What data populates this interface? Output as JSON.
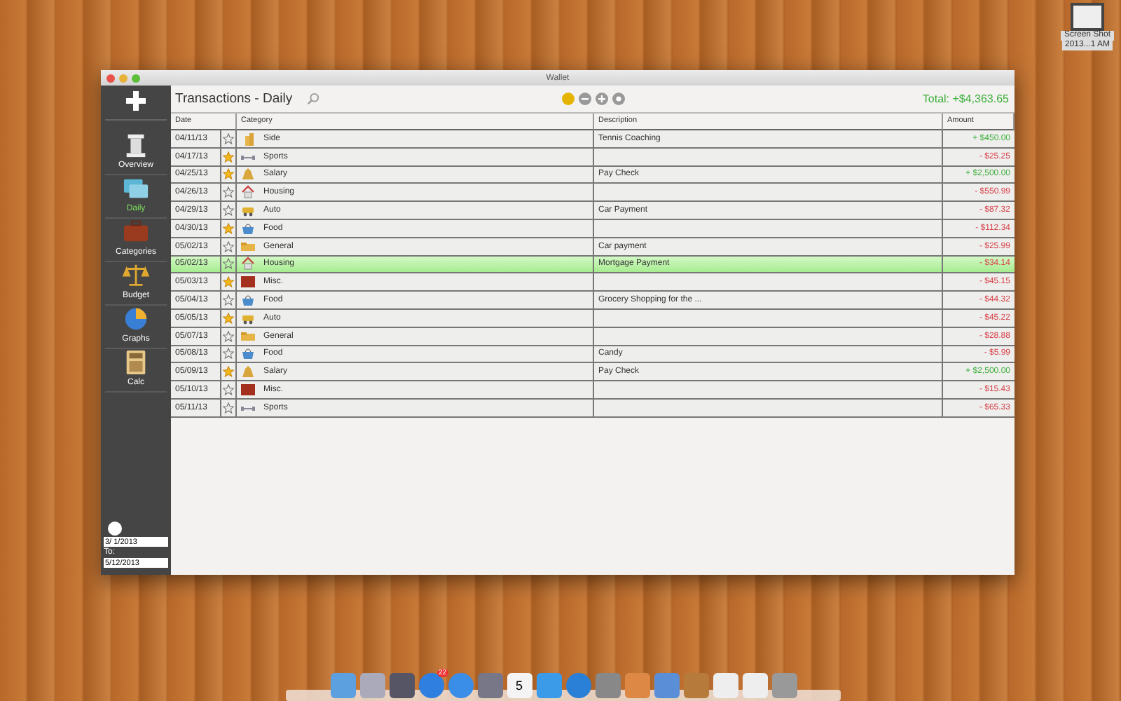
{
  "desktop_icon": {
    "label_line_1": "Screen Shot",
    "label_line_2": "2013...1 AM"
  },
  "window": {
    "title": "Wallet"
  },
  "sidebar": {
    "items": [
      {
        "label": "Overview",
        "kind": "column",
        "selected": false
      },
      {
        "label": "Daily",
        "kind": "cards",
        "selected": true
      },
      {
        "label": "Categories",
        "kind": "briefcase",
        "selected": false
      },
      {
        "label": "Budget",
        "kind": "scale",
        "selected": false
      },
      {
        "label": "Graphs",
        "kind": "pie",
        "selected": false
      },
      {
        "label": "Calc",
        "kind": "calculator",
        "selected": false
      }
    ],
    "from_date": "3/ 1/2013",
    "to_label": "To:",
    "to_date": "5/12/2013"
  },
  "toolbar": {
    "title": "Transactions - Daily",
    "total": "Total: +$4,363.65"
  },
  "table": {
    "columns": [
      "Date",
      "Category",
      "Description",
      "Amount"
    ],
    "rows": [
      {
        "date": "04/11/13",
        "starred": false,
        "category": "Side",
        "kind": "side",
        "description": "Tennis Coaching",
        "amount": "+ $450.00",
        "positive": true,
        "selected": false
      },
      {
        "date": "04/17/13",
        "starred": true,
        "category": "Sports",
        "kind": "sports",
        "description": "",
        "amount": "- $25.25",
        "positive": false,
        "selected": false
      },
      {
        "date": "04/25/13",
        "starred": true,
        "category": "Salary",
        "kind": "salary",
        "description": "Pay Check",
        "amount": "+ $2,500.00",
        "positive": true,
        "selected": false
      },
      {
        "date": "04/26/13",
        "starred": false,
        "category": "Housing",
        "kind": "housing",
        "description": "",
        "amount": "- $550.99",
        "positive": false,
        "selected": false
      },
      {
        "date": "04/29/13",
        "starred": false,
        "category": "Auto",
        "kind": "auto",
        "description": "Car Payment",
        "amount": "- $87.32",
        "positive": false,
        "selected": false
      },
      {
        "date": "04/30/13",
        "starred": true,
        "category": "Food",
        "kind": "food",
        "description": "",
        "amount": "- $112.34",
        "positive": false,
        "selected": false
      },
      {
        "date": "05/02/13",
        "starred": false,
        "category": "General",
        "kind": "general",
        "description": "Car payment",
        "amount": "- $25.99",
        "positive": false,
        "selected": false
      },
      {
        "date": "05/02/13",
        "starred": false,
        "category": "Housing",
        "kind": "housing",
        "description": "Mortgage Payment",
        "amount": "- $34.14",
        "positive": false,
        "selected": true
      },
      {
        "date": "05/03/13",
        "starred": true,
        "category": "Misc.",
        "kind": "misc",
        "description": "",
        "amount": "- $45.15",
        "positive": false,
        "selected": false
      },
      {
        "date": "05/04/13",
        "starred": false,
        "category": "Food",
        "kind": "food",
        "description": "Grocery Shopping for the ...",
        "amount": "- $44.32",
        "positive": false,
        "selected": false
      },
      {
        "date": "05/05/13",
        "starred": true,
        "category": "Auto",
        "kind": "auto",
        "description": "",
        "amount": "- $45.22",
        "positive": false,
        "selected": false
      },
      {
        "date": "05/07/13",
        "starred": false,
        "category": "General",
        "kind": "general",
        "description": "",
        "amount": "- $28.88",
        "positive": false,
        "selected": false
      },
      {
        "date": "05/08/13",
        "starred": false,
        "category": "Food",
        "kind": "food",
        "description": "Candy",
        "amount": "- $5.99",
        "positive": false,
        "selected": false
      },
      {
        "date": "05/09/13",
        "starred": true,
        "category": "Salary",
        "kind": "salary",
        "description": "Pay Check",
        "amount": "+ $2,500.00",
        "positive": true,
        "selected": false
      },
      {
        "date": "05/10/13",
        "starred": false,
        "category": "Misc.",
        "kind": "misc",
        "description": "",
        "amount": "- $15.43",
        "positive": false,
        "selected": false
      },
      {
        "date": "05/11/13",
        "starred": false,
        "category": "Sports",
        "kind": "sports",
        "description": "",
        "amount": "- $65.33",
        "positive": false,
        "selected": false
      }
    ]
  },
  "dock": {
    "app_store_badge": "22",
    "calendar_day": "5"
  }
}
